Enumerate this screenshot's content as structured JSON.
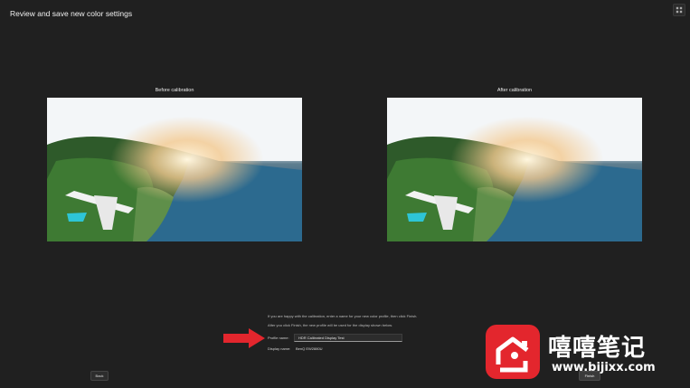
{
  "header": {
    "title": "Review and save new color settings"
  },
  "before": {
    "label": "Before calibration"
  },
  "after": {
    "label": "After calibration"
  },
  "instructions": {
    "line1": "If you are happy with the calibration, enter a name for your new color profile, then click Finish.",
    "line2": "After you click Finish, the new profile will be used for the display shown below."
  },
  "form": {
    "profile_label": "Profile name:",
    "profile_value": "HDR Calibrated Display Test",
    "display_label": "Display name:",
    "display_value": "BenQ EW2880U"
  },
  "buttons": {
    "back": "Back",
    "finish": "Finish"
  },
  "colors": {
    "background": "#202020",
    "arrow": "#e3262d",
    "logo": "#e3262d"
  },
  "watermark": {
    "text_cn": "嘻嘻笔记",
    "url": "www.bijixx.com"
  }
}
